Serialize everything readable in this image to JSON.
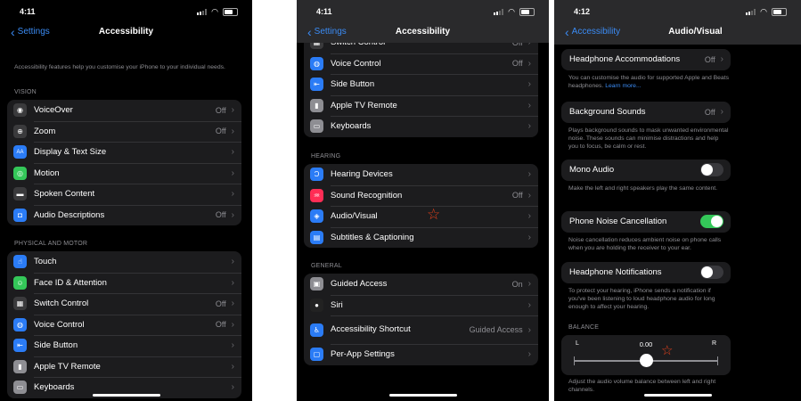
{
  "screen1": {
    "time": "4:11",
    "back": "Settings",
    "title": "Accessibility",
    "intro": "Accessibility features help you customise your iPhone to your individual needs.",
    "vision_header": "VISION",
    "vision": [
      {
        "label": "VoiceOver",
        "value": "Off",
        "icon": "voiceover-icon",
        "color": "#3a3a3c"
      },
      {
        "label": "Zoom",
        "value": "Off",
        "icon": "zoom-icon",
        "color": "#3a3a3c"
      },
      {
        "label": "Display & Text Size",
        "value": "",
        "icon": "text-size-icon",
        "color": "#2b7cf6",
        "glyph": "AA"
      },
      {
        "label": "Motion",
        "value": "",
        "icon": "motion-icon",
        "color": "#34c759"
      },
      {
        "label": "Spoken Content",
        "value": "",
        "icon": "speech-bubble-icon",
        "color": "#3a3a3c"
      },
      {
        "label": "Audio Descriptions",
        "value": "Off",
        "icon": "audio-description-icon",
        "color": "#2b7cf6"
      }
    ],
    "physical_header": "PHYSICAL AND MOTOR",
    "physical": [
      {
        "label": "Touch",
        "value": "",
        "icon": "touch-hand-icon",
        "color": "#2b7cf6"
      },
      {
        "label": "Face ID & Attention",
        "value": "",
        "icon": "face-id-icon",
        "color": "#34c759"
      },
      {
        "label": "Switch Control",
        "value": "Off",
        "icon": "switch-control-icon",
        "color": "#3a3a3c"
      },
      {
        "label": "Voice Control",
        "value": "Off",
        "icon": "voice-control-icon",
        "color": "#2b7cf6"
      },
      {
        "label": "Side Button",
        "value": "",
        "icon": "side-button-icon",
        "color": "#2b7cf6"
      },
      {
        "label": "Apple TV Remote",
        "value": "",
        "icon": "remote-icon",
        "color": "#8e8e93"
      },
      {
        "label": "Keyboards",
        "value": "",
        "icon": "keyboard-icon",
        "color": "#8e8e93"
      }
    ]
  },
  "screen2": {
    "time": "4:11",
    "back": "Settings",
    "title": "Accessibility",
    "top": [
      {
        "label": "Switch Control",
        "value": "Off",
        "icon": "switch-control-icon",
        "color": "#3a3a3c"
      },
      {
        "label": "Voice Control",
        "value": "Off",
        "icon": "voice-control-icon",
        "color": "#2b7cf6"
      },
      {
        "label": "Side Button",
        "value": "",
        "icon": "side-button-icon",
        "color": "#2b7cf6"
      },
      {
        "label": "Apple TV Remote",
        "value": "",
        "icon": "remote-icon",
        "color": "#8e8e93"
      },
      {
        "label": "Keyboards",
        "value": "",
        "icon": "keyboard-icon",
        "color": "#8e8e93"
      }
    ],
    "hearing_header": "HEARING",
    "hearing": [
      {
        "label": "Hearing Devices",
        "value": "",
        "icon": "ear-icon",
        "color": "#2b7cf6"
      },
      {
        "label": "Sound Recognition",
        "value": "Off",
        "icon": "sound-recognition-icon",
        "color": "#ff2d55"
      },
      {
        "label": "Audio/Visual",
        "value": "",
        "icon": "audio-visual-icon",
        "color": "#2b7cf6"
      },
      {
        "label": "Subtitles & Captioning",
        "value": "",
        "icon": "captions-icon",
        "color": "#2b7cf6"
      }
    ],
    "general_header": "GENERAL",
    "general": [
      {
        "label": "Guided Access",
        "value": "On",
        "icon": "lock-icon",
        "color": "#8e8e93"
      },
      {
        "label": "Siri",
        "value": "",
        "icon": "siri-icon",
        "color": "#222"
      },
      {
        "label": "Accessibility Shortcut",
        "value": "Guided Access",
        "icon": "accessibility-icon",
        "color": "#2b7cf6"
      },
      {
        "label": "Per-App Settings",
        "value": "",
        "icon": "per-app-icon",
        "color": "#2b7cf6"
      }
    ]
  },
  "screen3": {
    "time": "4:12",
    "back": "Accessibility",
    "title": "Audio/Visual",
    "headphone_accommodations": {
      "label": "Headphone Accommodations",
      "value": "Off"
    },
    "ha_footer": "You can customise the audio for supported Apple and Beats headphones.",
    "ha_link": "Learn more...",
    "background_sounds": {
      "label": "Background Sounds",
      "value": "Off"
    },
    "bs_footer": "Plays background sounds to mask unwanted environmental noise. These sounds can minimise distractions and help you to focus, be calm or rest.",
    "mono_audio": {
      "label": "Mono Audio",
      "on": false
    },
    "mono_footer": "Make the left and right speakers play the same content.",
    "noise_cancellation": {
      "label": "Phone Noise Cancellation",
      "on": true
    },
    "nc_footer": "Noise cancellation reduces ambient noise on phone calls when you are holding the receiver to your ear.",
    "headphone_notifications": {
      "label": "Headphone Notifications",
      "on": false
    },
    "hn_footer": "To protect your hearing, iPhone sends a notification if you've been listening to loud headphone audio for long enough to affect your hearing.",
    "balance_header": "BALANCE",
    "balance": {
      "left": "L",
      "right": "R",
      "value": "0.00",
      "level": 0.5
    },
    "balance_footer": "Adjust the audio volume balance between left and right channels."
  }
}
